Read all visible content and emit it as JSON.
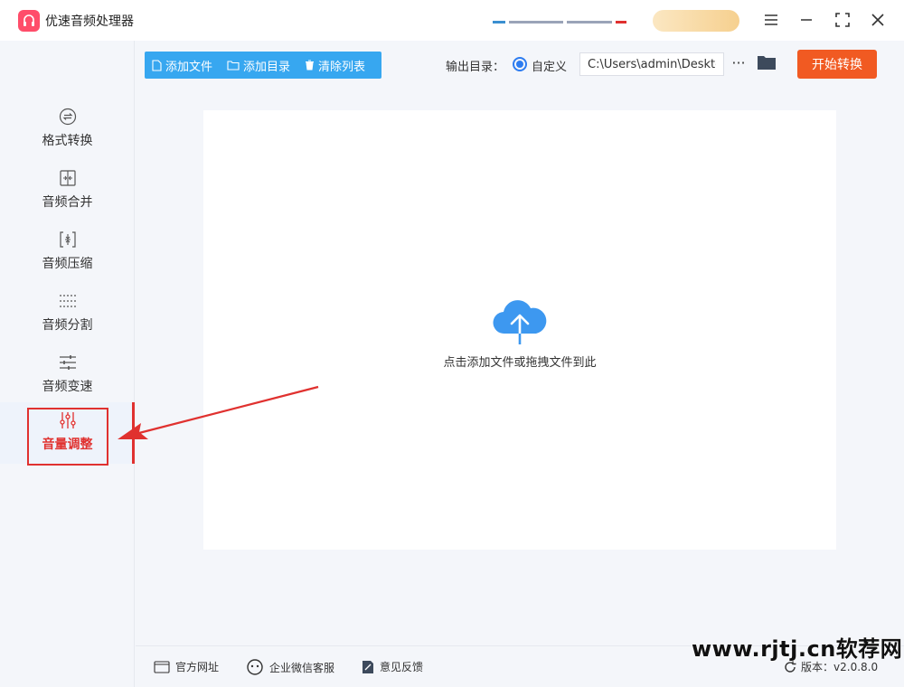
{
  "app": {
    "title": "优速音频处理器"
  },
  "sidebar": {
    "items": [
      {
        "label": "格式转换",
        "icon": "format-convert-icon"
      },
      {
        "label": "音频合并",
        "icon": "merge-icon"
      },
      {
        "label": "音频压缩",
        "icon": "compress-icon"
      },
      {
        "label": "音频分割",
        "icon": "split-icon"
      },
      {
        "label": "音频变速",
        "icon": "speed-icon"
      },
      {
        "label": "音量调整",
        "icon": "volume-sliders-icon",
        "active": true
      }
    ]
  },
  "toolbar": {
    "add_file": "添加文件",
    "add_folder": "添加目录",
    "clear_list": "清除列表",
    "output_label": "输出目录：",
    "custom_label": "自定义",
    "output_path": "C:\\Users\\admin\\Desktop",
    "more": "···",
    "start": "开始转换"
  },
  "dropzone": {
    "hint": "点击添加文件或拖拽文件到此"
  },
  "footer": {
    "website": "官方网址",
    "wechat": "企业微信客服",
    "feedback": "意见反馈",
    "version_label": "版本：",
    "version": "v2.0.8.0"
  },
  "watermark": "www.rjtj.cn软荐网",
  "colors": {
    "accent": "#37a7f0",
    "start": "#f15a22",
    "active": "#e0312f",
    "radio": "#2d7cf0"
  }
}
